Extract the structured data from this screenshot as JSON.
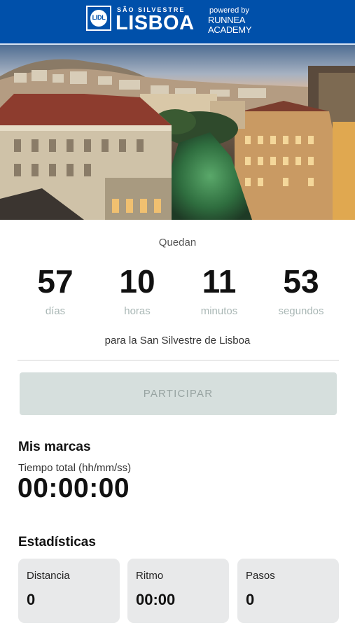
{
  "header": {
    "logo_text": "LIDL",
    "event_subtitle": "SÃO SILVESTRE",
    "event_title": "LISBOA",
    "powered_by": "powered by",
    "sponsor_line1": "RUNNEA",
    "sponsor_line2": "ACADEMY",
    "background_color": "#0050aa"
  },
  "hero": {
    "image_description_icon": "city-photo"
  },
  "countdown": {
    "heading": "Quedan",
    "units": [
      {
        "value": "57",
        "label": "días"
      },
      {
        "value": "10",
        "label": "horas"
      },
      {
        "value": "11",
        "label": "minutos"
      },
      {
        "value": "53",
        "label": "segundos"
      }
    ],
    "footer": "para la San Silvestre de Lisboa"
  },
  "actions": {
    "participate_label": "PARTICIPAR"
  },
  "marcas": {
    "title": "Mis marcas",
    "total_time_label": "Tiempo total (hh/mm/ss)",
    "total_time_value": "00:00:00"
  },
  "estadisticas": {
    "title": "Estadísticas",
    "cards": [
      {
        "label": "Distancia",
        "value": "0"
      },
      {
        "label": "Ritmo",
        "value": "00:00"
      },
      {
        "label": "Pasos",
        "value": "0"
      }
    ]
  }
}
